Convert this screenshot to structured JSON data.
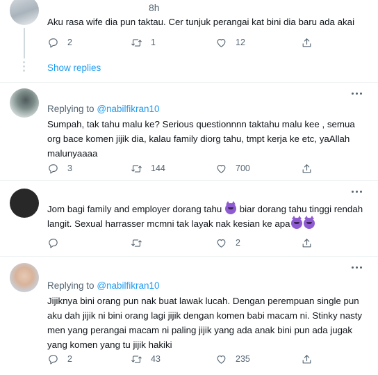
{
  "tweets": [
    {
      "time": "8h",
      "text": "Aku rasa wife dia pun taktau. Cer tunjuk perangai kat bini dia baru ada akai",
      "replies": "2",
      "retweets": "1",
      "likes": "12"
    },
    {
      "replying_label": "Replying to",
      "replying_handle": "@nabilfikran10",
      "text": "Sumpah, tak tahu malu ke? Serious questionnnn taktahu malu kee , semua org bace komen jijik dia, kalau family diorg tahu, tmpt kerja ke etc, yaAllah malunyaaaa",
      "replies": "3",
      "retweets": "144",
      "likes": "700"
    },
    {
      "text_part1": "Jom bagi family and employer dorang tahu ",
      "text_part2": " biar dorang tahu tinggi rendah langit. Sexual harrasser mcmni tak layak nak kesian ke apa",
      "replies": "",
      "retweets": "",
      "likes": "2"
    },
    {
      "replying_label": "Replying to",
      "replying_handle": "@nabilfikran10",
      "text": "Jijiknya bini orang pun nak buat lawak lucah. Dengan perempuan single pun aku dah jijik ni bini orang lagi jijik dengan komen babi macam ni. Stinky nasty men yang perangai macam ni paling jijik yang ada anak bini pun ada jugak yang komen yang tu jijik hakiki",
      "replies": "2",
      "retweets": "43",
      "likes": "235"
    }
  ],
  "show_replies": "Show replies",
  "icons": {
    "reply": "reply-icon",
    "retweet": "retweet-icon",
    "like": "heart-icon",
    "share": "share-icon",
    "more": "more-icon",
    "emoji": "smiling-devil-emoji"
  },
  "colors": {
    "text": "#0f1419",
    "secondary": "#536471",
    "accent": "#1d9bf0",
    "divider": "#eff3f4"
  }
}
